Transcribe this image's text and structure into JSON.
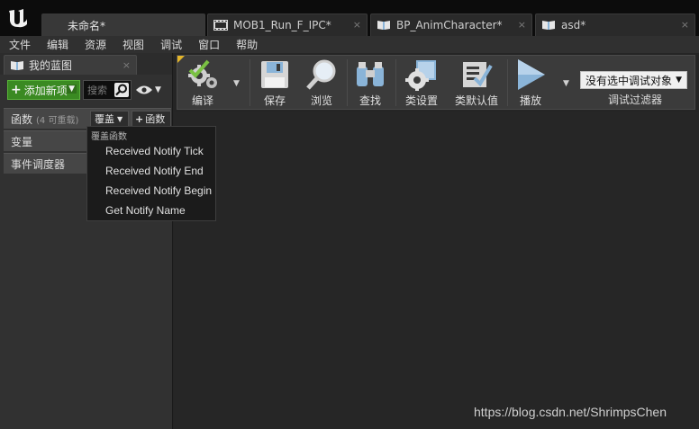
{
  "titlebar": {
    "tabs": [
      {
        "label": "未命名*",
        "icon": "none",
        "active": true
      },
      {
        "label": "MOB1_Run_F_IPC*",
        "icon": "film-strip-icon",
        "active": false
      },
      {
        "label": "BP_AnimCharacter*",
        "icon": "book-icon",
        "active": false
      },
      {
        "label": "asd*",
        "icon": "book-icon",
        "active": false
      }
    ],
    "close_glyph": "×"
  },
  "menubar": {
    "items": [
      "文件",
      "编辑",
      "资源",
      "视图",
      "调试",
      "窗口",
      "帮助"
    ]
  },
  "left_panel": {
    "tab_label": "我的蓝图",
    "add_new_label": "添加新项",
    "search_placeholder": "搜索",
    "categories": {
      "functions": {
        "label": "函数",
        "sub": "(4 可重载)",
        "override_label": "覆盖",
        "add_function_label": "函数"
      },
      "variables": {
        "label": "变量"
      },
      "event_dispatchers": {
        "label": "事件调度器"
      }
    }
  },
  "dropdown": {
    "heading": "覆盖函数",
    "items": [
      "Received Notify Tick",
      "Received Notify End",
      "Received Notify Begin",
      "Get Notify Name"
    ]
  },
  "toolbar": {
    "compile_label": "编译",
    "save_label": "保存",
    "browse_label": "浏览",
    "find_label": "查找",
    "class_settings_label": "类设置",
    "class_defaults_label": "类默认值",
    "play_label": "播放",
    "debug_object": "没有选中调试对象",
    "debug_filter_label": "调试过滤器"
  },
  "watermark": "https://blog.csdn.net/ShrimpsChen",
  "colors": {
    "accent_green": "#3a8a22",
    "compile_check": "#7ac143",
    "tab_corner": "#e3b52a"
  }
}
